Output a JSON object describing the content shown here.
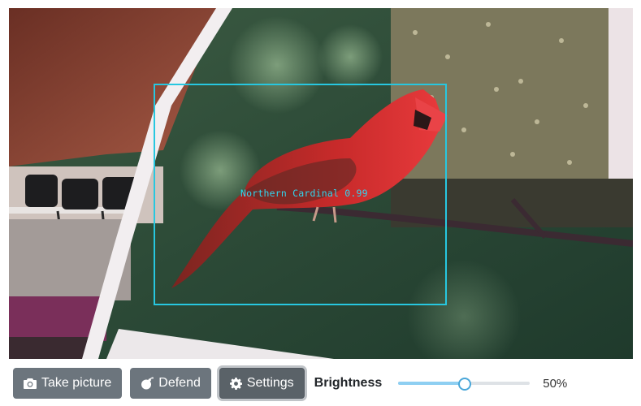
{
  "camera": {
    "detection_label": "Northern Cardinal 0.99"
  },
  "controls": {
    "take_picture_label": "Take picture",
    "take_picture_icon": "camera-icon",
    "defend_label": "Defend",
    "defend_icon": "bomb-icon",
    "settings_label": "Settings",
    "settings_icon": "gear-icon",
    "settings_active": true,
    "brightness_label": "Brightness",
    "brightness_level": 0.5,
    "brightness_value": "50%"
  },
  "colors": {
    "button_bg": "#6c757d",
    "detection_box": "#27c7e0",
    "slider_fill": "#8ecff2"
  }
}
